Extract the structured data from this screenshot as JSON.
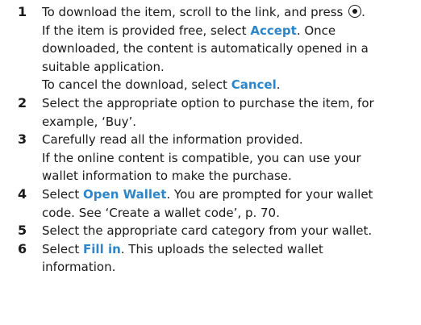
{
  "steps": [
    {
      "number": "1",
      "lines": {
        "l1_pre": "To download the item, scroll to the link, and press",
        "l1_post": ".",
        "l2_pre": "If the item is provided free, select ",
        "l2_ui": "Accept",
        "l2_post": ". Once",
        "l3": "downloaded, the content is automatically opened in a",
        "l4": "suitable application.",
        "l5_pre": "To cancel the download, select ",
        "l5_ui": "Cancel",
        "l5_post": "."
      },
      "icon": "select-key-icon"
    },
    {
      "number": "2",
      "lines": {
        "l1": "Select the appropriate option to purchase the item, for",
        "l2": "example, ‘Buy’."
      }
    },
    {
      "number": "3",
      "lines": {
        "l1": "Carefully read all the information provided.",
        "l2": "If the online content is compatible, you can use your",
        "l3": "wallet information to make the purchase."
      }
    },
    {
      "number": "4",
      "lines": {
        "l1_pre": "Select ",
        "l1_ui": "Open Wallet",
        "l1_post": ". You are prompted for your wallet",
        "l2": "code. See ‘Create a wallet code’, p. 70."
      }
    },
    {
      "number": "5",
      "lines": {
        "l1": "Select the appropriate card category from your wallet."
      }
    },
    {
      "number": "6",
      "lines": {
        "l1_pre": "Select ",
        "l1_ui": "Fill in",
        "l1_post": ". This uploads the selected wallet",
        "l2": "information."
      }
    }
  ],
  "colors": {
    "ui_text": "#2e86c9",
    "body_text": "#1a1a1a"
  }
}
